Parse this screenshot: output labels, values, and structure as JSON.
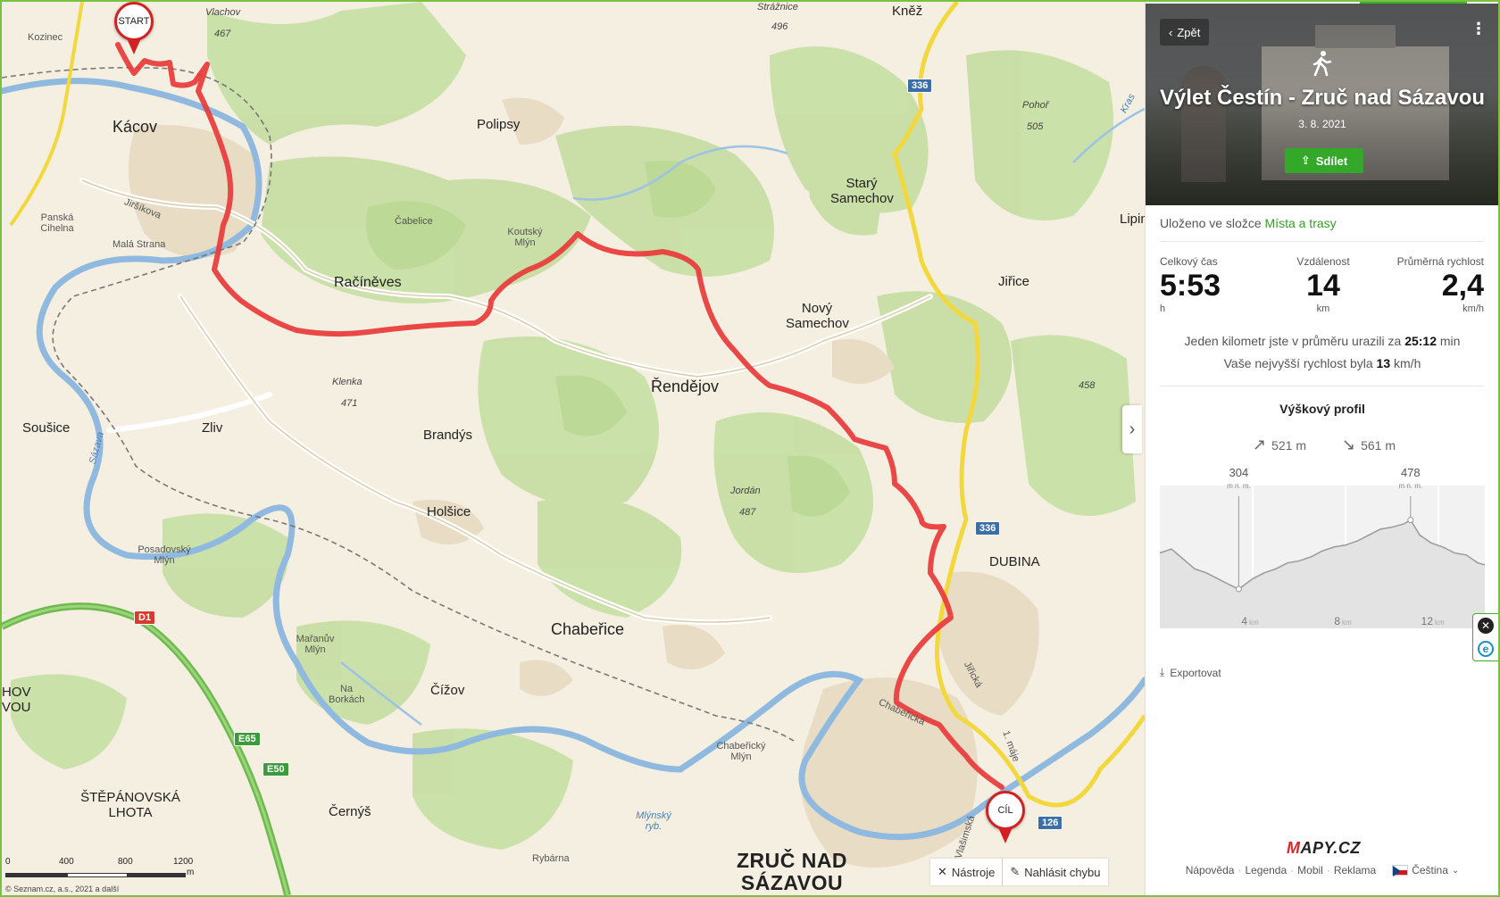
{
  "map": {
    "pins": {
      "start": "START",
      "end": "CÍL"
    },
    "places": [
      {
        "id": "kozinec",
        "text": "Kozinec"
      },
      {
        "id": "vlachov",
        "text": "Vlachov"
      },
      {
        "id": "vlachov-alt",
        "text": "467"
      },
      {
        "id": "straznice",
        "text": "Strážnice"
      },
      {
        "id": "straznice-alt",
        "text": "496"
      },
      {
        "id": "knez",
        "text": "Kněž"
      },
      {
        "id": "kacov",
        "text": "Kácov"
      },
      {
        "id": "polipsy",
        "text": "Polipsy"
      },
      {
        "id": "pohor",
        "text": "Pohoř"
      },
      {
        "id": "pohor-alt",
        "text": "505"
      },
      {
        "id": "panska-cihelna",
        "text": "Panská Cihelna"
      },
      {
        "id": "jirsikova",
        "text": "Jiršíkova"
      },
      {
        "id": "mala-strana",
        "text": "Malá Strana"
      },
      {
        "id": "cabelice",
        "text": "Čabelice"
      },
      {
        "id": "koutsky-mlyn",
        "text": "Koutský Mlýn"
      },
      {
        "id": "stary-samechov",
        "text": "Starý Samechov"
      },
      {
        "id": "lipin",
        "text": "Lipin"
      },
      {
        "id": "racineves",
        "text": "Račíněves"
      },
      {
        "id": "jirice",
        "text": "Jiřice"
      },
      {
        "id": "novy-samechov",
        "text": "Nový Samechov"
      },
      {
        "id": "klenka",
        "text": "Klenka"
      },
      {
        "id": "klenka-alt",
        "text": "471"
      },
      {
        "id": "rendejov",
        "text": "Řendějov"
      },
      {
        "id": "h458",
        "text": "458"
      },
      {
        "id": "sousice",
        "text": "Soušice"
      },
      {
        "id": "zliv",
        "text": "Zliv"
      },
      {
        "id": "brandys",
        "text": "Brandýs"
      },
      {
        "id": "sazava",
        "text": "Sázava"
      },
      {
        "id": "jordan",
        "text": "Jordán"
      },
      {
        "id": "jordan-alt",
        "text": "487"
      },
      {
        "id": "holsice",
        "text": "Holšice"
      },
      {
        "id": "dubina",
        "text": "DUBINA"
      },
      {
        "id": "posadovsky-mlyn",
        "text": "Posadovský Mlýn"
      },
      {
        "id": "chaberice",
        "text": "Chabeřice"
      },
      {
        "id": "mananuv-mlyn",
        "text": "Mařanův Mlýn"
      },
      {
        "id": "na-borkach",
        "text": "Na Borkách"
      },
      {
        "id": "cizov",
        "text": "Čížov"
      },
      {
        "id": "hov-vou",
        "text": "HOV VOU"
      },
      {
        "id": "chaberice-street",
        "text": "Chabeřická"
      },
      {
        "id": "jiricka",
        "text": "Jiřická"
      },
      {
        "id": "1-maje",
        "text": "1. máje"
      },
      {
        "id": "chaberucky-mlyn",
        "text": "Chabeřický Mlýn"
      },
      {
        "id": "stepanovska-lhota",
        "text": "ŠTĚPÁNOVSKÁ LHOTA"
      },
      {
        "id": "mlynsky-ryb",
        "text": "Mlýnský ryb."
      },
      {
        "id": "cernys",
        "text": "Černýš"
      },
      {
        "id": "vlasimska",
        "text": "Vlašimská"
      },
      {
        "id": "rybarna",
        "text": "Rybárna"
      },
      {
        "id": "zruc",
        "text": "ZRUČ NAD SÁZAVOU"
      },
      {
        "id": "kras",
        "text": "Kras"
      }
    ],
    "road_badges": {
      "r336a": "336",
      "r336b": "336",
      "r126": "126",
      "d1": "D1",
      "e65": "E65",
      "e50": "E50"
    },
    "scale": {
      "t0": "0",
      "t1": "400",
      "t2": "800",
      "t3": "1200",
      "unit": "m"
    },
    "copyright": "© Seznam.cz, a.s., 2021 a další",
    "tools": {
      "tools_label": "Nástroje",
      "report_label": "Nahlásit chybu"
    },
    "toggle_icon": "chevron-right-icon"
  },
  "panel": {
    "back_label": "Zpět",
    "title": "Výlet Čestín - Zruč nad Sázavou",
    "date": "3. 8. 2021",
    "share_label": "Sdílet",
    "saved_prefix": "Uloženo ve složce",
    "saved_link": "Místa a trasy",
    "stats": {
      "time": {
        "label": "Celkový čas",
        "value": "5:53",
        "unit": "h"
      },
      "distance": {
        "label": "Vzdálenost",
        "value": "14",
        "unit": "km"
      },
      "speed": {
        "label": "Průměrná rychlost",
        "value": "2,4",
        "unit": "km/h"
      }
    },
    "pace": {
      "prefix": "Jeden kilometr jste v průměru urazili za",
      "value": "25:12",
      "suffix": "min"
    },
    "max_speed": {
      "prefix": "Vaše nejvyšší rychlost byla",
      "value": "13",
      "suffix": "km/h"
    },
    "profile": {
      "title": "Výškový profil",
      "ascent": "521 m",
      "descent": "561 m"
    },
    "export_label": "Exportovat",
    "logo": {
      "first": "M",
      "rest": "APY.CZ"
    },
    "footer": {
      "help": "Nápověda",
      "legend": "Legenda",
      "mobile": "Mobil",
      "ads": "Reklama",
      "lang": "Čeština"
    }
  },
  "chart_data": {
    "type": "area",
    "title": "Výškový profil",
    "xlabel": "",
    "ylabel": "",
    "x_unit": "km",
    "x_ticks": [
      4,
      8,
      12
    ],
    "xlim": [
      0,
      14
    ],
    "ylim": [
      250,
      520
    ],
    "annotations": [
      {
        "x": 3.4,
        "y": 304,
        "label": "304",
        "sub": "m n. m."
      },
      {
        "x": 10.8,
        "y": 478,
        "label": "478",
        "sub": "m n. m."
      }
    ],
    "series": [
      {
        "x": [
          0,
          0.5,
          1.0,
          1.5,
          2.0,
          2.5,
          3.0,
          3.4,
          4.0,
          4.5,
          5.0,
          5.5,
          6.0,
          6.5,
          7.0,
          7.5,
          8.0,
          8.5,
          9.0,
          9.5,
          10.0,
          10.5,
          10.8,
          11.2,
          11.7,
          12.2,
          12.7,
          13.2,
          13.7,
          14.0
        ],
        "y": [
          395,
          405,
          380,
          355,
          345,
          330,
          315,
          304,
          330,
          345,
          355,
          370,
          375,
          385,
          400,
          410,
          415,
          425,
          440,
          455,
          460,
          468,
          478,
          440,
          420,
          410,
          395,
          390,
          370,
          365
        ]
      }
    ]
  }
}
